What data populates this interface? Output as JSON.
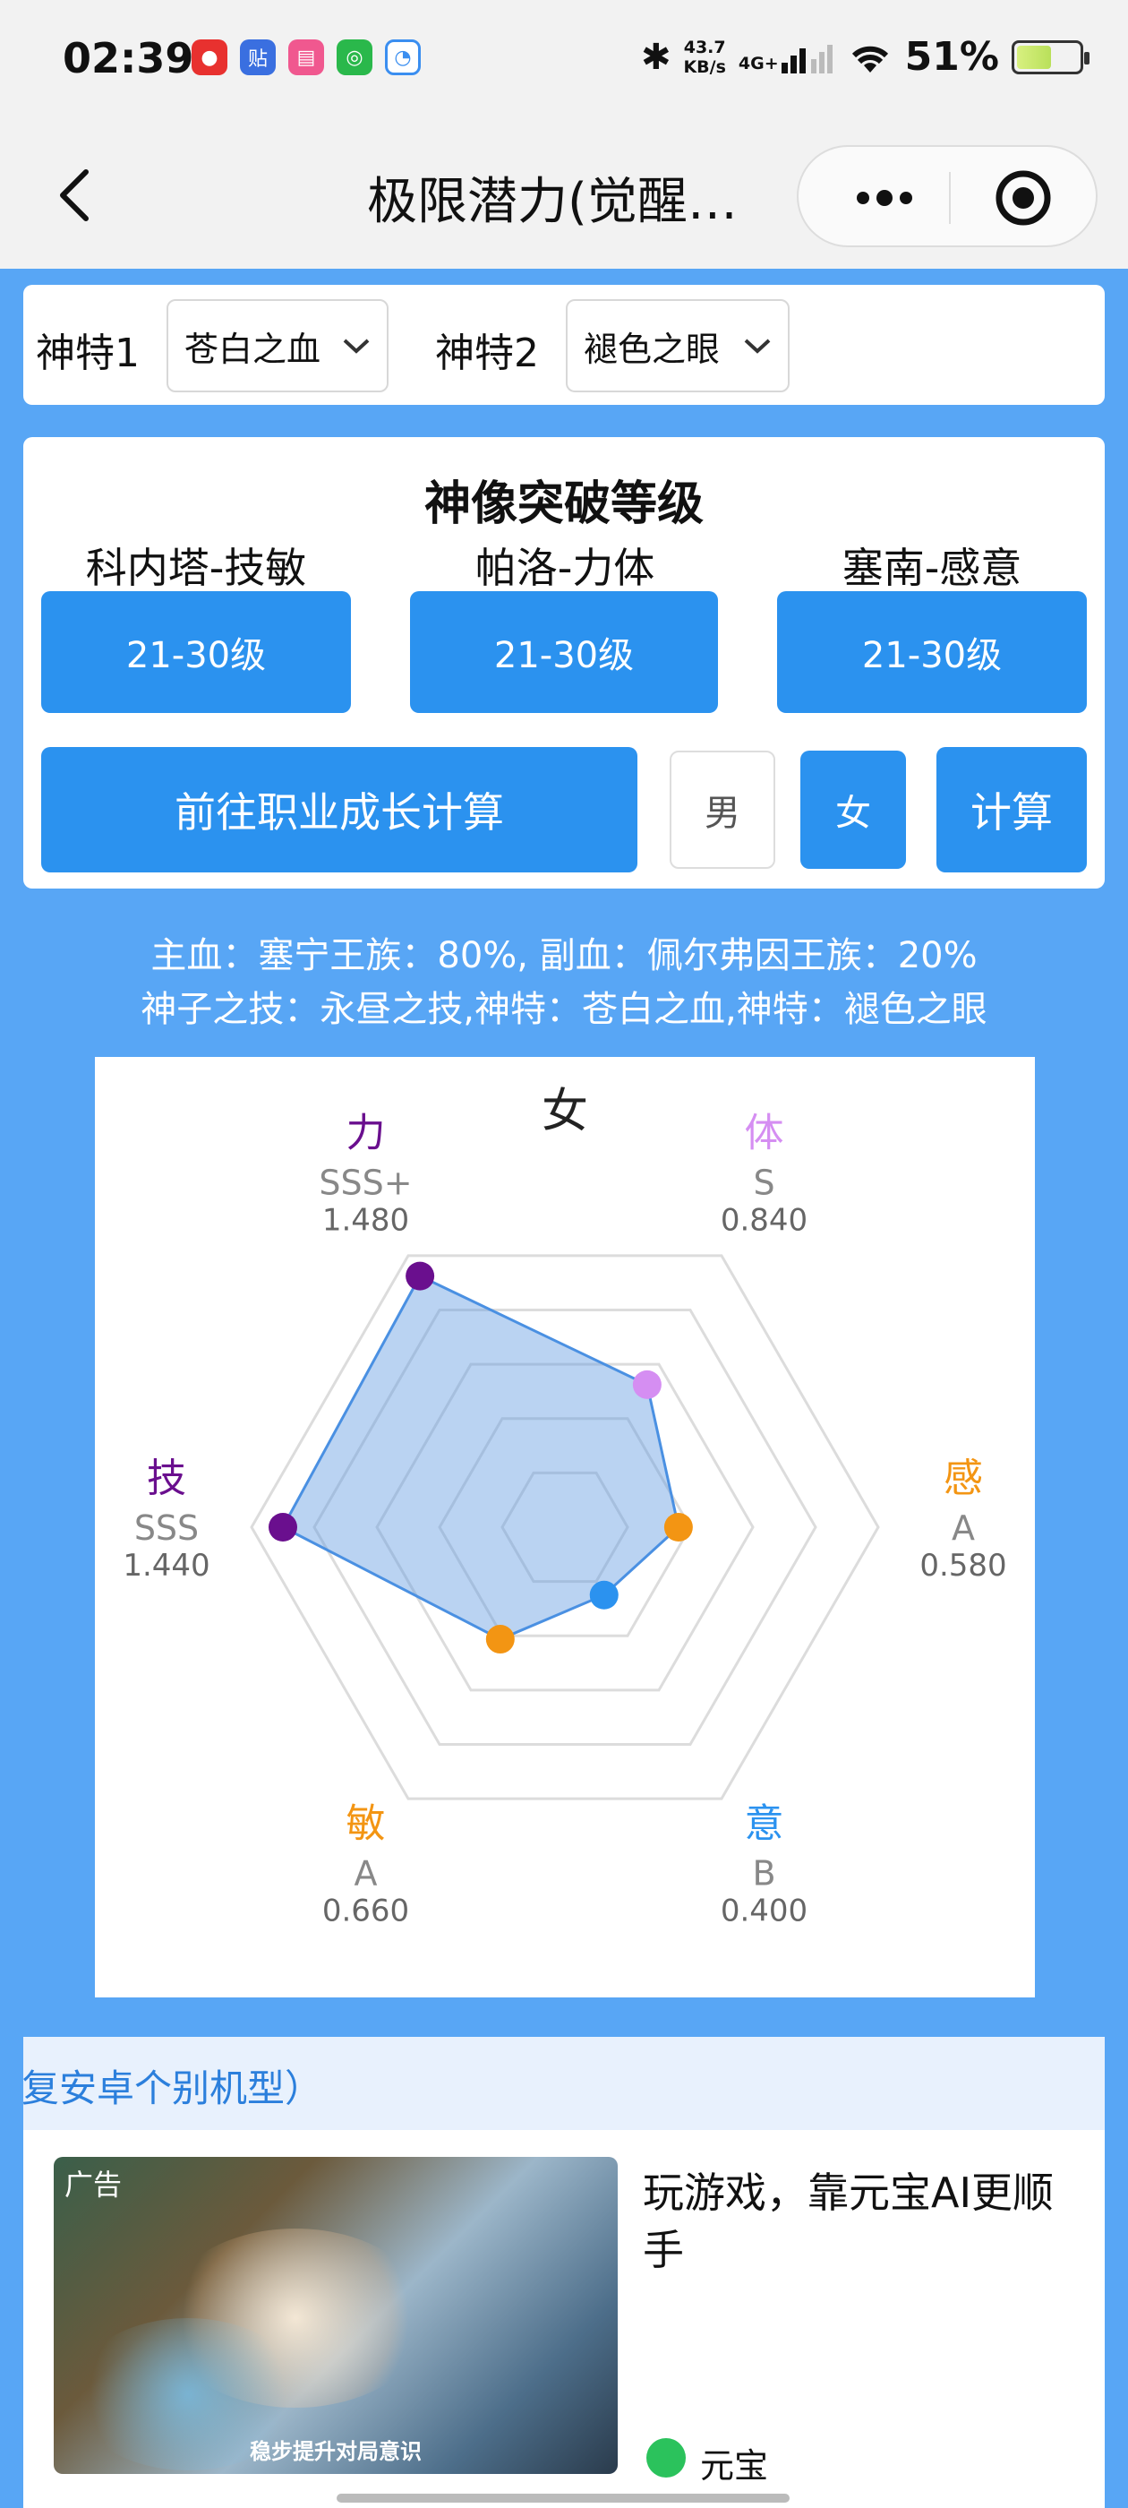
{
  "status_bar": {
    "time": "02:39",
    "net_speed_top": "43.7",
    "net_speed_bottom": "KB/s",
    "network": "4G+",
    "battery": "51%",
    "app_icons": [
      "weibo-icon",
      "tieba-icon",
      "bilibili-icon",
      "wechat-icon",
      "browser-icon"
    ]
  },
  "nav": {
    "title": "极限潜力(觉醒…",
    "icons": [
      "back-icon",
      "more-icon",
      "target-icon"
    ]
  },
  "selectors": [
    {
      "label": "神特1",
      "value": "苍白之血"
    },
    {
      "label": "神特2",
      "value": "褪色之眼"
    }
  ],
  "breakthrough": {
    "title": "神像突破等级",
    "columns": [
      {
        "label": "科内塔-技敏",
        "value": "21-30级"
      },
      {
        "label": "帕洛-力体",
        "value": "21-30级"
      },
      {
        "label": "塞南-感意",
        "value": "21-30级"
      }
    ],
    "career_button": "前往职业成长计算",
    "male_button": "男",
    "female_button": "女",
    "calc_button": "计算"
  },
  "info": {
    "line1": "主血：塞宁王族：80%, 副血：佩尔弗因王族：20%",
    "line2": "神子之技：永昼之技,神特：苍白之血,神特：褪色之眼"
  },
  "chart_data": {
    "type": "radar",
    "title": "女",
    "max": 1.6,
    "rings": 5,
    "axes": [
      {
        "name": "力",
        "grade": "SSS+",
        "value": 1.48,
        "display": "1.480",
        "color": "#6a0f8e"
      },
      {
        "name": "体",
        "grade": "S",
        "value": 0.84,
        "display": "0.840",
        "color": "#d58ef2"
      },
      {
        "name": "感",
        "grade": "A",
        "value": 0.58,
        "display": "0.580",
        "color": "#f39513"
      },
      {
        "name": "意",
        "grade": "B",
        "value": 0.4,
        "display": "0.400",
        "color": "#2b92ef"
      },
      {
        "name": "敏",
        "grade": "A",
        "value": 0.66,
        "display": "0.660",
        "color": "#f39513"
      },
      {
        "name": "技",
        "grade": "SSS",
        "value": 1.44,
        "display": "1.440",
        "color": "#6a0f8e"
      }
    ]
  },
  "notice": {
    "text": "复安卓个别机型）"
  },
  "ad": {
    "tag": "广告",
    "caption": "稳步提升对局意识",
    "title": "玩游戏，靠元宝AI更顺手",
    "brand": "元宝"
  }
}
